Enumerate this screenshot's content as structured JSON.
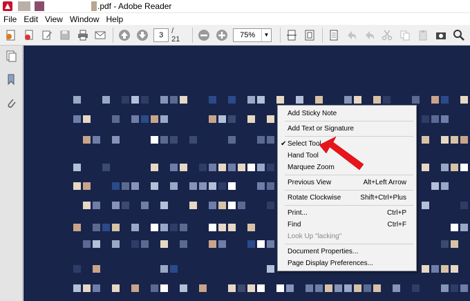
{
  "window": {
    "title": ".pdf - Adobe Reader"
  },
  "menubar": {
    "items": [
      "File",
      "Edit",
      "View",
      "Window",
      "Help"
    ]
  },
  "toolbar": {
    "page_current": "3",
    "page_total": "/ 21",
    "zoom": "75%"
  },
  "context_menu": {
    "items": [
      {
        "label": "Add Sticky Note",
        "shortcut": ""
      },
      {
        "label": "Add Text or Signature",
        "shortcut": ""
      },
      {
        "label": "Select Tool",
        "shortcut": "",
        "checked": true
      },
      {
        "label": "Hand Tool",
        "shortcut": ""
      },
      {
        "label": "Marquee Zoom",
        "shortcut": ""
      },
      {
        "label": "Previous View",
        "shortcut": "Alt+Left Arrow"
      },
      {
        "label": "Rotate Clockwise",
        "shortcut": "Shift+Ctrl+Plus"
      },
      {
        "label": "Print...",
        "shortcut": "Ctrl+P"
      },
      {
        "label": "Find",
        "shortcut": "Ctrl+F"
      },
      {
        "label": "Look Up \"lacking\"",
        "shortcut": "",
        "disabled": true
      },
      {
        "label": "Document Properties...",
        "shortcut": ""
      },
      {
        "label": "Page Display Preferences...",
        "shortcut": ""
      }
    ]
  },
  "colors": {
    "document_bg": "#18244a",
    "annotation_arrow": "#e8141b"
  }
}
